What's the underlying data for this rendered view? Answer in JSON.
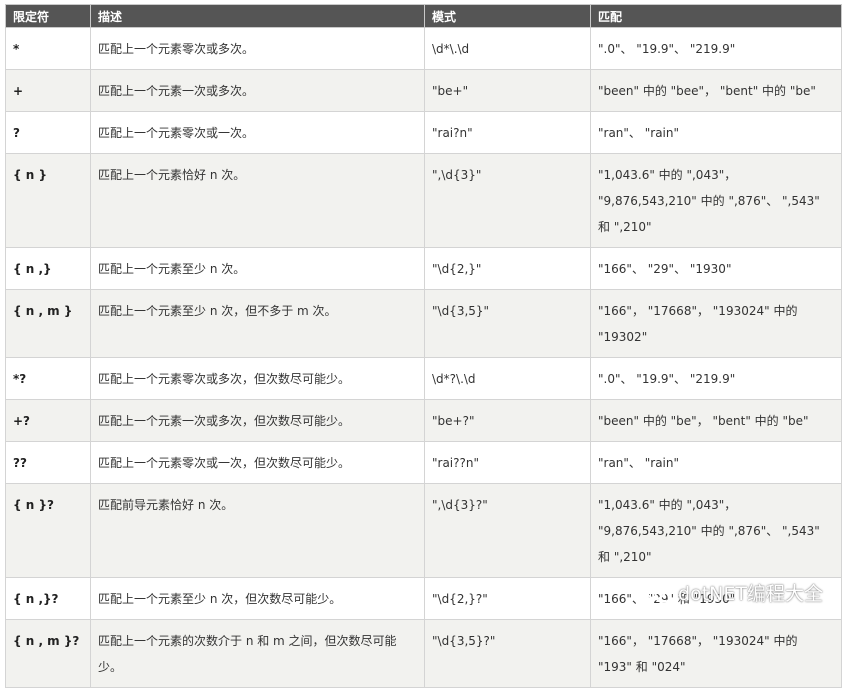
{
  "headers": [
    "限定符",
    "描述",
    "模式",
    "匹配"
  ],
  "rows": [
    {
      "sym": "*",
      "desc": "匹配上一个元素零次或多次。",
      "pattern": "\\d*\\.\\d",
      "match": "\".0\"、 \"19.9\"、 \"219.9\""
    },
    {
      "sym": "+",
      "desc": "匹配上一个元素一次或多次。",
      "pattern": "\"be+\"",
      "match": "\"been\" 中的 \"bee\"， \"bent\" 中的 \"be\""
    },
    {
      "sym": "?",
      "desc": "匹配上一个元素零次或一次。",
      "pattern": "\"rai?n\"",
      "match": "\"ran\"、 \"rain\""
    },
    {
      "sym": "{ n }",
      "desc": "匹配上一个元素恰好 n 次。",
      "pattern": "\",\\d{3}\"",
      "match": "\"1,043.6\" 中的 \",043\"， \"9,876,543,210\" 中的 \",876\"、 \",543\" 和 \",210\""
    },
    {
      "sym": "{ n ,}",
      "desc": "匹配上一个元素至少 n 次。",
      "pattern": "\"\\d{2,}\"",
      "match": "\"166\"、 \"29\"、 \"1930\""
    },
    {
      "sym": "{ n , m }",
      "desc": "匹配上一个元素至少 n 次，但不多于 m 次。",
      "pattern": "\"\\d{3,5}\"",
      "match": "\"166\"， \"17668\"， \"193024\" 中的 \"19302\""
    },
    {
      "sym": "*?",
      "desc": "匹配上一个元素零次或多次，但次数尽可能少。",
      "pattern": "\\d*?\\.\\d",
      "match": "\".0\"、 \"19.9\"、 \"219.9\""
    },
    {
      "sym": "+?",
      "desc": "匹配上一个元素一次或多次，但次数尽可能少。",
      "pattern": "\"be+?\"",
      "match": "\"been\" 中的 \"be\"， \"bent\" 中的 \"be\""
    },
    {
      "sym": "??",
      "desc": "匹配上一个元素零次或一次，但次数尽可能少。",
      "pattern": "\"rai??n\"",
      "match": "\"ran\"、 \"rain\""
    },
    {
      "sym": "{ n }?",
      "desc": "匹配前导元素恰好 n 次。",
      "pattern": "\",\\d{3}?\"",
      "match": "\"1,043.6\" 中的 \",043\"， \"9,876,543,210\" 中的 \",876\"、 \",543\" 和 \",210\""
    },
    {
      "sym": "{ n ,}?",
      "desc": "匹配上一个元素至少 n 次，但次数尽可能少。",
      "pattern": "\"\\d{2,}?\"",
      "match": "\"166\"、 \"29\" 和 \"1930\""
    },
    {
      "sym": "{ n , m }?",
      "desc": "匹配上一个元素的次数介于 n 和 m 之间，但次数尽可能少。",
      "pattern": "\"\\d{3,5}?\"",
      "match": "\"166\"， \"17668\"， \"193024\" 中的 \"193\" 和 \"024\""
    }
  ],
  "watermark": "dotNET编程大全"
}
